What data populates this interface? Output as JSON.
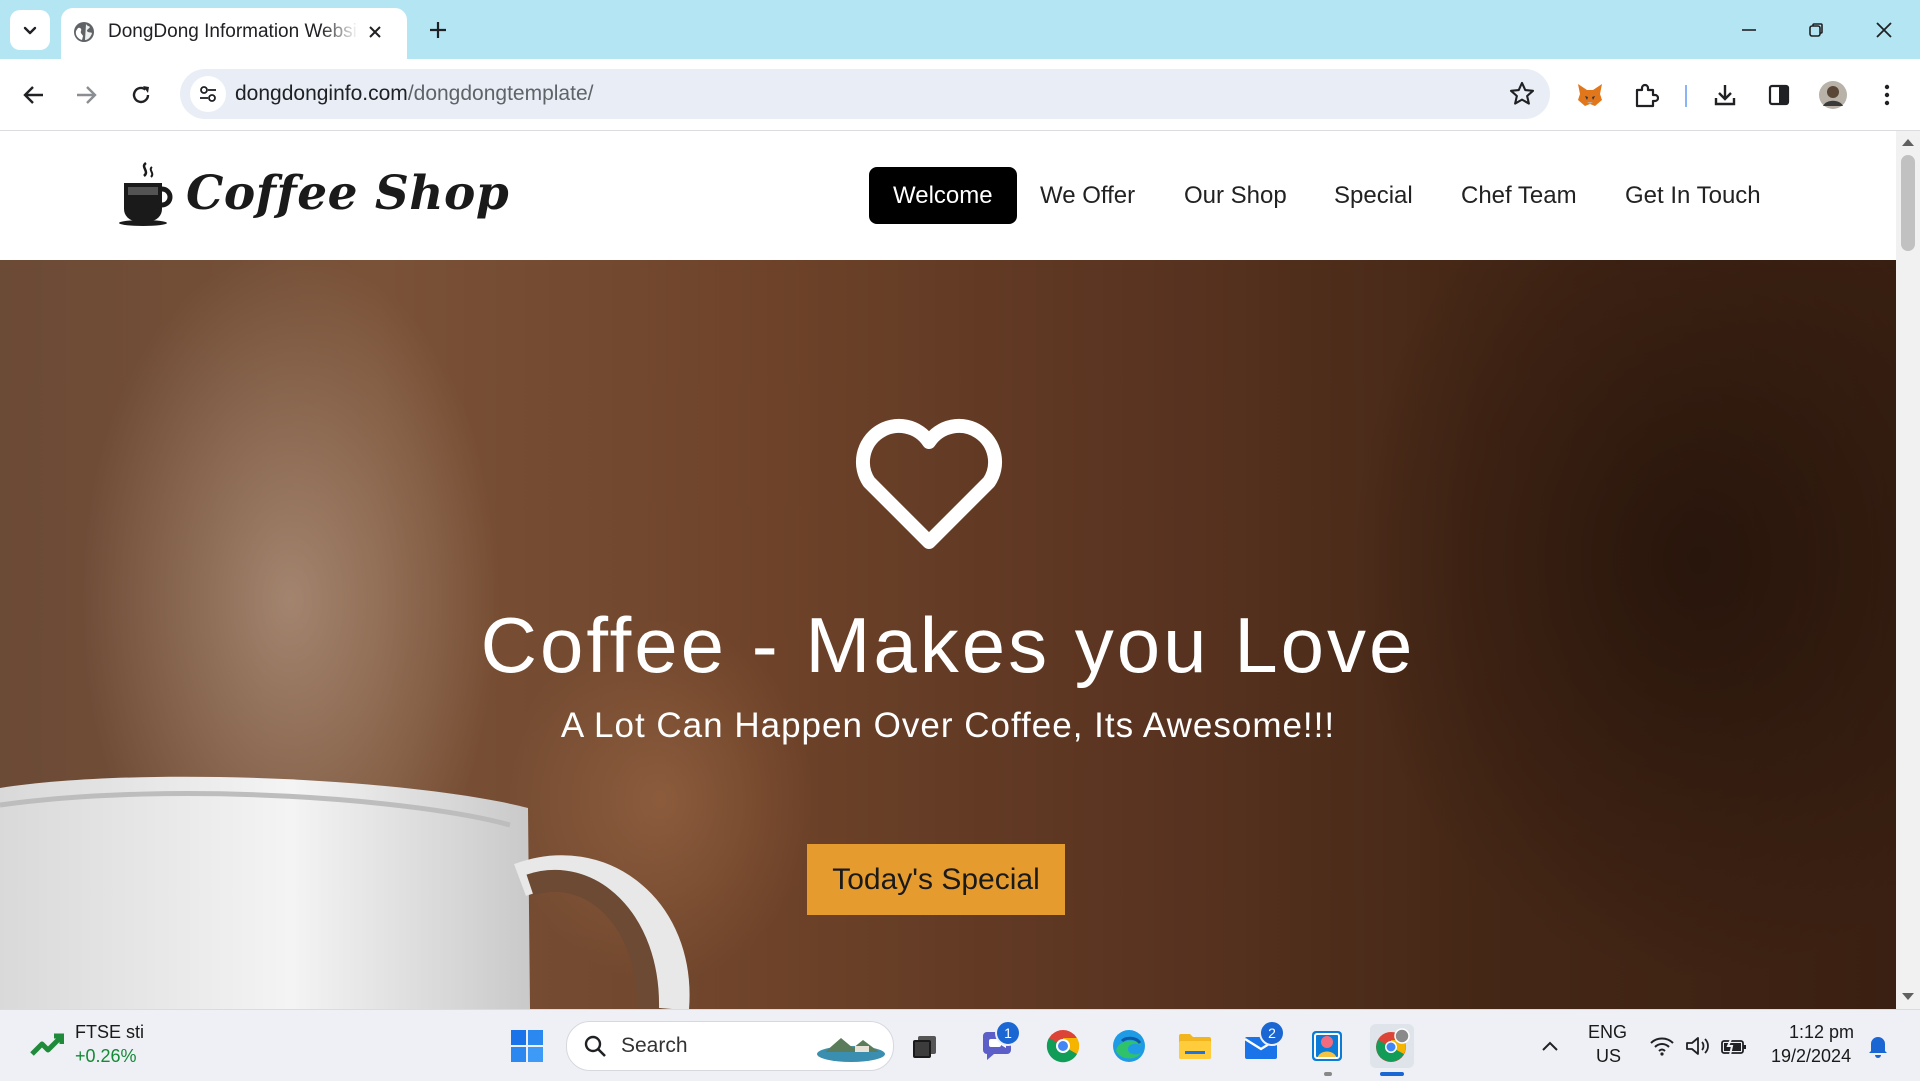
{
  "browser": {
    "tab_title": "DongDong Information Website",
    "url_domain": "dongdonginfo.com",
    "url_path": "/dongdongtemplate/"
  },
  "site": {
    "logo_text": "Coffee Shop",
    "menu": [
      "Welcome",
      "We Offer",
      "Our Shop",
      "Special",
      "Chef Team",
      "Get In Touch"
    ],
    "active_menu": "Welcome"
  },
  "hero": {
    "title": "Coffee - Makes you Love",
    "subtitle": "A Lot Can Happen Over Coffee, Its Awesome!!!",
    "button_label": "Today's Special",
    "button_color": "#e69b2f"
  },
  "taskbar": {
    "stock_name": "FTSE sti",
    "stock_change": "+0.26%",
    "search_label": "Search",
    "teams_badge": "1",
    "mail_badge": "2",
    "language": "ENG",
    "region": "US",
    "time": "1:12 pm",
    "date": "19/2/2024"
  }
}
